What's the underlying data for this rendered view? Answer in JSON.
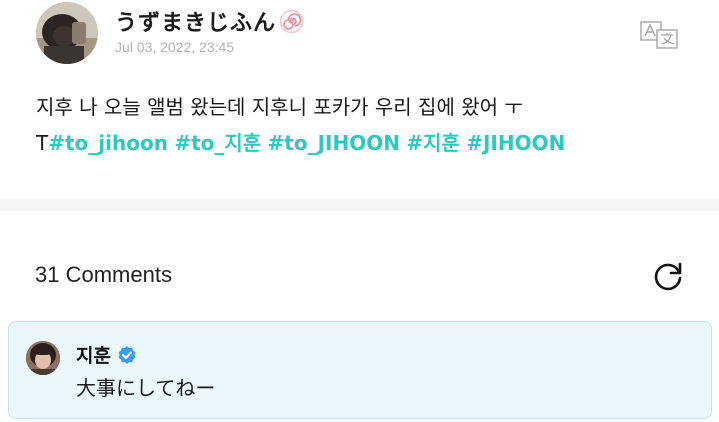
{
  "post": {
    "username": "うずまきじふん",
    "username_icon": "narutomaki-icon",
    "timestamp": "Jul 03, 2022, 23:45",
    "translate_icon": "translate-icon",
    "text_line1": "지후 나 오늘 앨범 왔는데 지후니 포카가 우리 집에 왔어 ㅜ",
    "text_line2_prefix": "T",
    "hashtags": [
      "#to_jihoon",
      "#to_지훈",
      "#to_JIHOON",
      "#지훈",
      "#JIHOON"
    ]
  },
  "comments": {
    "count_label": "31 Comments",
    "refresh_icon": "refresh-icon",
    "items": [
      {
        "author": "지훈",
        "verified": true,
        "text": "大事にしてねー"
      }
    ]
  },
  "colors": {
    "hashtag": "#2bc9c0",
    "verified": "#3b9df0",
    "comment_bg": "#eaf8fc",
    "divider": "#f4f5f7"
  }
}
